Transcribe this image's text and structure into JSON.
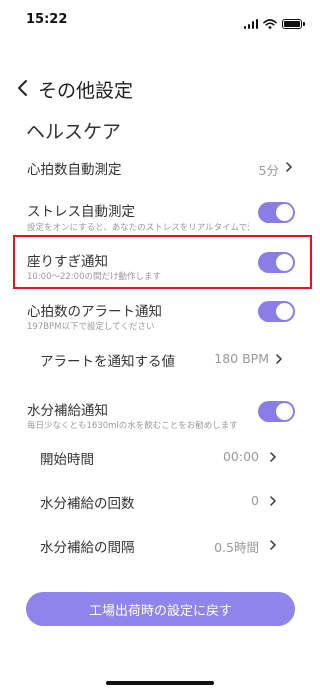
{
  "status_bar": {
    "time": "15:22"
  },
  "nav": {
    "title": "その他設定"
  },
  "section": {
    "title": "ヘルスケア"
  },
  "rows": {
    "heart_rate": {
      "label": "心拍数自動測定",
      "value": "5分"
    },
    "stress": {
      "label": "ストレス自動測定",
      "sub": "設定をオンにすると、あなたのストレスをリアルタイムで測定します",
      "enabled": true
    },
    "sitting": {
      "label": "座りすぎ通知",
      "sub": "10:00～22:00の間だけ動作します",
      "enabled": true
    },
    "hr_alert": {
      "label": "心拍数のアラート通知",
      "sub": "197BPM以下で設定してください",
      "enabled": true
    },
    "alert_value": {
      "label": "アラートを通知する値",
      "value": "180 BPM"
    },
    "water": {
      "label": "水分補給通知",
      "sub": "毎日少なくとも1630mlの水を飲むことをお勧めします",
      "enabled": true
    },
    "start_time": {
      "label": "開始時間",
      "value": "00:00"
    },
    "water_count": {
      "label": "水分補給の回数",
      "value": "0"
    },
    "water_interval": {
      "label": "水分補給の間隔",
      "value": "0.5時間"
    }
  },
  "reset_button": {
    "label": "工場出荷時の設定に戻す"
  },
  "colors": {
    "accent": "#8a7ee6",
    "button": "#8f84ec",
    "highlight": "#e8121e"
  }
}
